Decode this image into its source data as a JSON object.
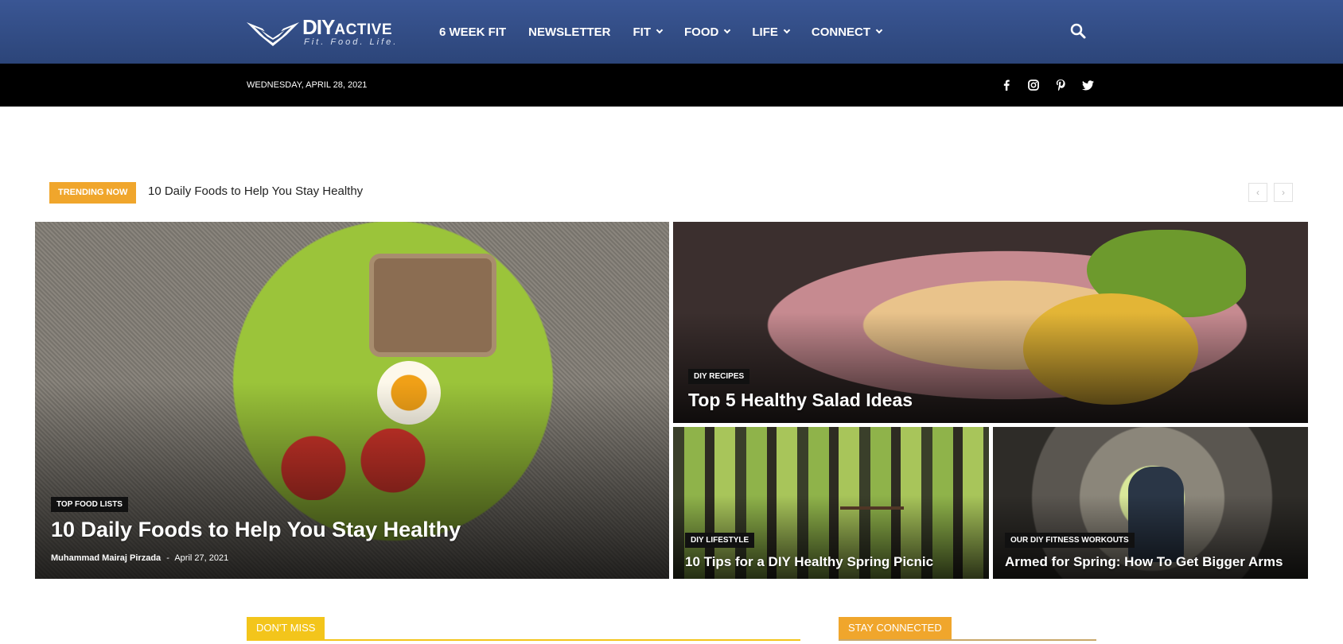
{
  "logo": {
    "brand_main": "DIY",
    "brand_sub": "ACTIVE",
    "tagline": "Fit. Food. Life."
  },
  "nav": {
    "items": [
      {
        "label": "6 WEEK FIT",
        "dropdown": false
      },
      {
        "label": "NEWSLETTER",
        "dropdown": false
      },
      {
        "label": "FIT",
        "dropdown": true
      },
      {
        "label": "FOOD",
        "dropdown": true
      },
      {
        "label": "LIFE",
        "dropdown": true
      },
      {
        "label": "CONNECT",
        "dropdown": true
      }
    ],
    "search_icon": "search-icon"
  },
  "subbar": {
    "date": "WEDNESDAY, APRIL 28, 2021",
    "socials": [
      "facebook-icon",
      "instagram-icon",
      "pinterest-icon",
      "twitter-icon"
    ]
  },
  "trending": {
    "badge": "TRENDING NOW",
    "title": "10 Daily Foods to Help You Stay Healthy",
    "prev": "‹",
    "next": "›"
  },
  "featured": [
    {
      "category": "TOP FOOD LISTS",
      "title": "10 Daily Foods to Help You Stay Healthy",
      "author": "Muhammad Mairaj Pirzada",
      "separator": "-",
      "date": "April 27, 2021"
    },
    {
      "category": "DIY RECIPES",
      "title": "Top 5 Healthy Salad Ideas"
    },
    {
      "category": "DIY LIFESTYLE",
      "title": "10 Tips for a DIY Healthy Spring Picnic"
    },
    {
      "category": "OUR DIY FITNESS WORKOUTS",
      "title": "Armed for Spring: How To Get Bigger Arms"
    }
  ],
  "sections": {
    "dont_miss": "DON'T MISS",
    "stay_connected": "STAY CONNECTED"
  },
  "colors": {
    "header_blue": "#34508a",
    "accent_orange": "#f0a62c",
    "accent_yellow": "#f3c51b"
  }
}
